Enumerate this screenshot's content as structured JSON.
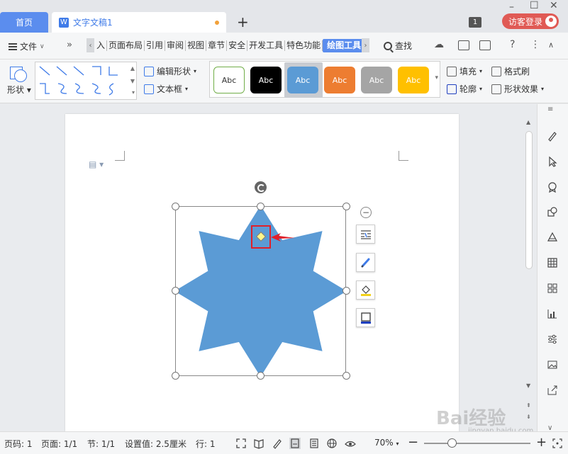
{
  "titlebar": {
    "home_tab": "首页",
    "doc_tab_title": "文字文稿1",
    "add_tab": "+",
    "window_count": "1",
    "login_label": "访客登录"
  },
  "menubar": {
    "file_label": "文件",
    "more": "»",
    "tabs": [
      "入",
      "页面布局",
      "引用",
      "审阅",
      "视图",
      "章节",
      "安全",
      "开发工具",
      "特色功能",
      "绘图工具"
    ],
    "search_label": "查找",
    "help": "?"
  },
  "ribbon": {
    "shape_label": "形状",
    "edit_shape_label": "编辑形状",
    "textbox_label": "文本框",
    "style_labels": [
      "Abc",
      "Abc",
      "Abc",
      "Abc",
      "Abc",
      "Abc"
    ],
    "style_colors": [
      "#ffffff",
      "#000000",
      "#5b9bd5",
      "#ed7d31",
      "#a5a5a5",
      "#ffc000"
    ],
    "fill_label": "填充",
    "outline_label": "轮廓",
    "format_painter_label": "格式刷",
    "shape_effect_label": "形状效果"
  },
  "colors": {
    "accent": "#5b8dee",
    "shape_fill": "#5b9bd5",
    "login_bg": "#e05a55",
    "highlight_red": "#e0202a"
  },
  "statusbar": {
    "page_num": "页码: 1",
    "page_total": "页面: 1/1",
    "section": "节: 1/1",
    "setting": "设置值: 2.5厘米",
    "row": "行: 1",
    "zoom": "70%",
    "zoom_fraction": 0.26
  },
  "watermark": {
    "brand": "Bai经验",
    "url": "jingyan.baidu.com"
  }
}
